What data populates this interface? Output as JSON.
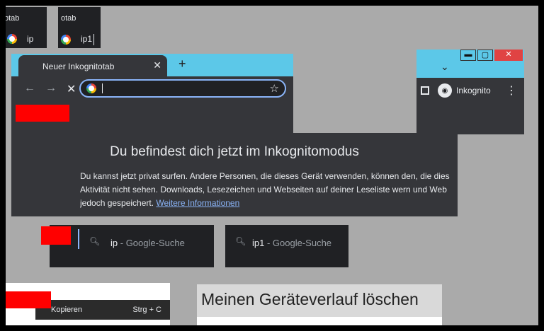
{
  "small_tabs": [
    {
      "title": "otab",
      "text": "ip"
    },
    {
      "title": "otab",
      "text": "ip1"
    }
  ],
  "browser": {
    "tab_title": "Neuer Inkognitotab",
    "close_glyph": "✕",
    "newtab_glyph": "+",
    "back_glyph": "←",
    "forward_glyph": "→",
    "stop_glyph": "✕",
    "star_glyph": "☆",
    "accent": "#5cc8e8"
  },
  "window": {
    "minimize": "▬",
    "maximize": "▢",
    "close": "✕",
    "chevron": "⌄",
    "incognito_label": "Inkognito",
    "menu_glyph": "⋮"
  },
  "incognito_page": {
    "headline": "Du befindest dich jetzt im Inkognitomodus",
    "line1": "Du kannst jetzt privat surfen. Andere Personen, die dieses Gerät verwenden, können den, die dies",
    "line2": "Aktivität nicht sehen. Downloads, Lesezeichen und Webseiten auf deiner Leseliste wern und Web",
    "line3_prefix": "jedoch gespeichert.",
    "link": "Weitere Informationen"
  },
  "suggestions": [
    {
      "query": "ip",
      "suffix": "- Google-Suche"
    },
    {
      "query": "ip1",
      "suffix": "- Google-Suche"
    }
  ],
  "context_menu": {
    "item": "Kopieren",
    "shortcut": "Strg + C"
  },
  "big_button": {
    "label": "Meinen Geräteverlauf löschen"
  }
}
